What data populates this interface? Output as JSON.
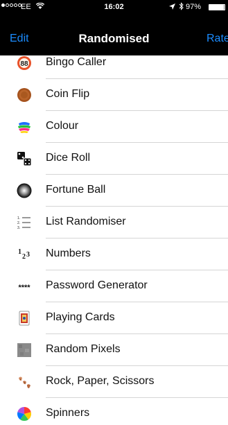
{
  "status_bar": {
    "carrier": "EE",
    "time": "16:02",
    "battery": "97%",
    "battery_level": 0.97
  },
  "nav": {
    "edit": "Edit",
    "title": "Randomised",
    "rate": "Rate"
  },
  "items": [
    {
      "label": "Bingo Caller",
      "icon": "bingo-ball-icon",
      "badge": "88"
    },
    {
      "label": "Coin Flip",
      "icon": "coin-icon"
    },
    {
      "label": "Colour",
      "icon": "colour-splash-icon"
    },
    {
      "label": "Dice Roll",
      "icon": "dice-icon"
    },
    {
      "label": "Fortune Ball",
      "icon": "fortune-ball-icon"
    },
    {
      "label": "List Randomiser",
      "icon": "numbered-list-icon",
      "badge": "1. 2. 3."
    },
    {
      "label": "Numbers",
      "icon": "numbers-icon",
      "badge": "123"
    },
    {
      "label": "Password Generator",
      "icon": "password-icon",
      "badge": "****"
    },
    {
      "label": "Playing Cards",
      "icon": "playing-card-icon"
    },
    {
      "label": "Random Pixels",
      "icon": "pixels-icon"
    },
    {
      "label": "Rock, Paper, Scissors",
      "icon": "rock-paper-scissors-icon"
    },
    {
      "label": "Spinners",
      "icon": "spinner-icon"
    }
  ],
  "colors": {
    "accent": "#1b8cff",
    "bar": "#000000",
    "separator": "#d5d5d5"
  }
}
